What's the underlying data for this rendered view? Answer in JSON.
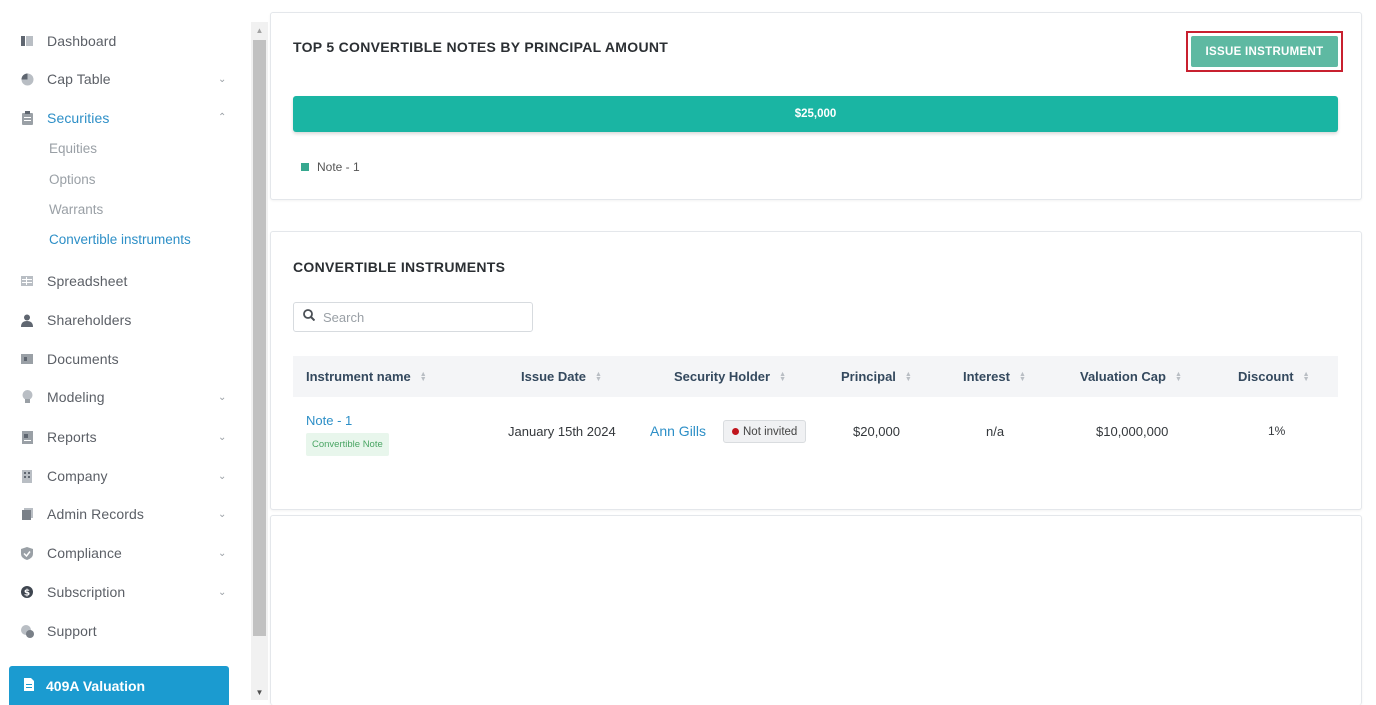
{
  "sidebar": {
    "items": [
      {
        "label": "Dashboard",
        "icon": "dashboard-icon"
      },
      {
        "label": "Cap Table",
        "icon": "pie-chart-icon"
      },
      {
        "label": "Securities",
        "icon": "clipboard-icon"
      },
      {
        "label": "Spreadsheet",
        "icon": "spreadsheet-icon"
      },
      {
        "label": "Shareholders",
        "icon": "person-icon"
      },
      {
        "label": "Documents",
        "icon": "folder-icon"
      },
      {
        "label": "Modeling",
        "icon": "lightbulb-icon"
      },
      {
        "label": "Reports",
        "icon": "reports-icon"
      },
      {
        "label": "Company",
        "icon": "building-icon"
      },
      {
        "label": "Admin Records",
        "icon": "records-icon"
      },
      {
        "label": "Compliance",
        "icon": "shield-icon"
      },
      {
        "label": "Subscription",
        "icon": "dollar-icon"
      },
      {
        "label": "Support",
        "icon": "support-icon"
      }
    ],
    "securities_sub": [
      "Equities",
      "Options",
      "Warrants",
      "Convertible instruments"
    ],
    "valuation_label": "409A Valuation"
  },
  "chart_card": {
    "title": "TOP 5 CONVERTIBLE NOTES BY PRINCIPAL AMOUNT",
    "issue_button": "ISSUE INSTRUMENT"
  },
  "chart_data": {
    "type": "bar",
    "categories": [
      "Note - 1"
    ],
    "values": [
      25000
    ],
    "data_labels": [
      "$25,000"
    ],
    "legend": [
      "Note - 1"
    ],
    "colors": {
      "bar": "#1ab5a3",
      "legend": "#36a88f"
    }
  },
  "instruments": {
    "title": "CONVERTIBLE INSTRUMENTS",
    "search_placeholder": "Search",
    "columns": [
      "Instrument name",
      "Issue Date",
      "Security Holder",
      "Principal",
      "Interest",
      "Valuation Cap",
      "Discount"
    ],
    "rows": [
      {
        "name": "Note - 1",
        "type_badge": "Convertible Note",
        "issue_date": "January 15th 2024",
        "holder": "Ann Gills",
        "holder_status": "Not invited",
        "principal": "$20,000",
        "interest": "n/a",
        "valuation_cap": "$10,000,000",
        "discount": "1%"
      }
    ]
  },
  "colors": {
    "accent": "#2d8fc7",
    "primary_button": "#5eb9a2",
    "valuation_button": "#1b9bd0",
    "highlight_border": "#c8202f"
  }
}
